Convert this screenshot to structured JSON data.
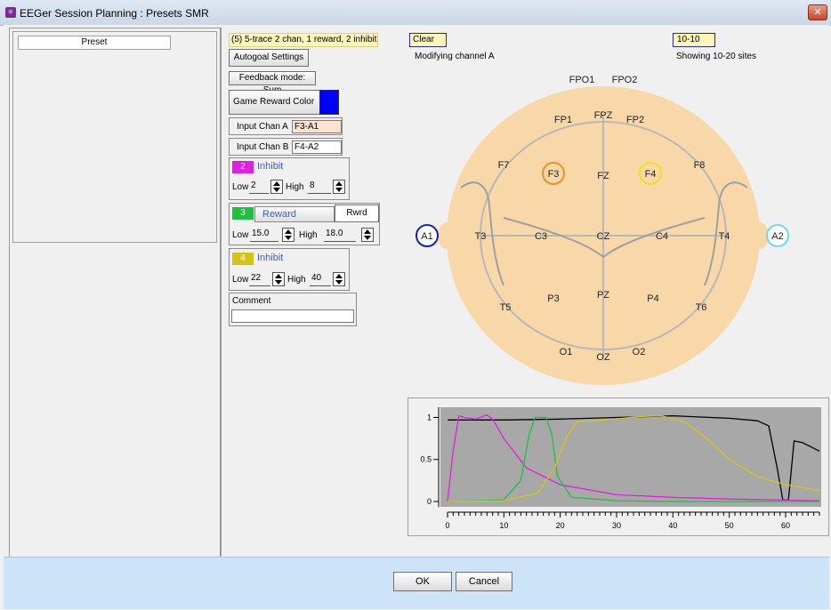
{
  "window": {
    "title": "EEGer Session Planning : Presets SMR",
    "close_glyph": "✕"
  },
  "preset_list": {
    "header": "Preset"
  },
  "description": "(5) 5-trace 2 chan, 1 reward, 2 inhibit",
  "buttons": {
    "autogoal": "Autogoal Settings",
    "feedback_mode": "Feedback mode: Sum",
    "game_reward_color": "Game Reward Color",
    "game_reward_color_value": "#0000ff",
    "clear": "Clear",
    "montage": "10-10",
    "ok": "OK",
    "cancel": "Cancel"
  },
  "channels": {
    "a_label": "Input Chan A",
    "a_value": "F3-A1",
    "b_label": "Input Chan B",
    "b_value": "F4-A2"
  },
  "bands": [
    {
      "number": "2",
      "type": "Inhibit",
      "color": "#e020e0",
      "low": "2",
      "high": "8"
    },
    {
      "number": "3",
      "type": "Reward",
      "color": "#1ec040",
      "low": "15.0",
      "high": "18.0",
      "extra_button": "Rwrd"
    },
    {
      "number": "4",
      "type": "Inhibit",
      "color": "#d4c418",
      "low": "22",
      "high": "40"
    }
  ],
  "labels": {
    "low": "Low",
    "high": "High",
    "comment": "Comment"
  },
  "comment_value": "",
  "status": {
    "modifying": "Modifying channel A",
    "showing": "Showing 10-20 sites"
  },
  "head_map": {
    "sites": [
      "FPO1",
      "FPO2",
      "FP1",
      "FPZ",
      "FP2",
      "F7",
      "F3",
      "FZ",
      "F4",
      "F8",
      "A1",
      "T3",
      "C3",
      "CZ",
      "C4",
      "T4",
      "A2",
      "T5",
      "P3",
      "PZ",
      "P4",
      "T6",
      "O1",
      "OZ",
      "O2"
    ],
    "highlighted": {
      "F3": "#f09020",
      "F4": "#f0e020",
      "A1": "#1020c0",
      "A2": "#70d8f0"
    },
    "head_color": "#f8d8a8"
  },
  "chart_data": {
    "type": "line",
    "title": "",
    "xlabel": "",
    "ylabel": "",
    "xlim": [
      0,
      66
    ],
    "ylim": [
      0,
      1.1
    ],
    "x_ticks": [
      0,
      10,
      20,
      30,
      40,
      50,
      60
    ],
    "y_ticks": [
      0,
      0.5,
      1
    ],
    "y_tick_labels": [
      "0",
      "0.5",
      "1"
    ],
    "series": [
      {
        "color": "#000000",
        "x": [
          0,
          10,
          20,
          30,
          40,
          50,
          55,
          57,
          58.5,
          59.5,
          60.5,
          61.5,
          63,
          66
        ],
        "y": [
          0.97,
          0.97,
          0.98,
          1.0,
          1.02,
          0.99,
          0.96,
          0.9,
          0.4,
          0.02,
          0.02,
          0.72,
          0.7,
          0.6
        ]
      },
      {
        "color": "#e020e0",
        "x": [
          0,
          1,
          2,
          3,
          5,
          7,
          8,
          10,
          14,
          20,
          30,
          40,
          50,
          66
        ],
        "y": [
          0,
          0.6,
          1.02,
          1.0,
          0.98,
          1.03,
          0.98,
          0.75,
          0.4,
          0.2,
          0.08,
          0.05,
          0.03,
          0.01
        ]
      },
      {
        "color": "#1ec040",
        "x": [
          0,
          10,
          13,
          14.5,
          15.5,
          17.5,
          18.5,
          19.5,
          22,
          30,
          40,
          66
        ],
        "y": [
          0,
          0.02,
          0.25,
          0.8,
          1.0,
          1.0,
          0.8,
          0.3,
          0.05,
          0.01,
          0.0,
          0.0
        ]
      },
      {
        "color": "#d4c418",
        "x": [
          0,
          10,
          16,
          19,
          21,
          23,
          28,
          34,
          38,
          42,
          46,
          50,
          55,
          60,
          66
        ],
        "y": [
          0,
          0.01,
          0.1,
          0.4,
          0.75,
          0.95,
          0.97,
          1.01,
          1.02,
          0.95,
          0.75,
          0.5,
          0.3,
          0.2,
          0.13
        ]
      }
    ]
  }
}
